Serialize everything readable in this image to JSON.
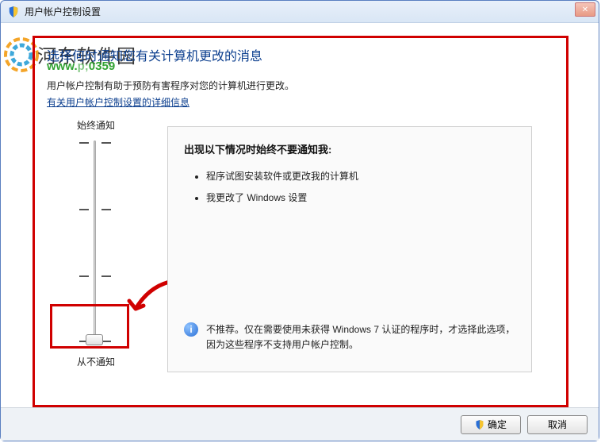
{
  "window": {
    "title": "用户帐户控制设置"
  },
  "page": {
    "heading": "选择何时通知您有关计算机更改的消息",
    "subtext": "用户帐户控制有助于预防有害程序对您的计算机进行更改。",
    "link": "有关用户帐户控制设置的详细信息"
  },
  "slider": {
    "top_label": "始终通知",
    "bottom_label": "从不通知"
  },
  "panel": {
    "heading": "出现以下情况时始终不要通知我:",
    "bullets": [
      "程序试图安装软件或更改我的计算机",
      "我更改了 Windows 设置"
    ],
    "recommendation": "不推荐。仅在需要使用未获得 Windows 7 认证的程序时，才选择此选项，因为这些程序不支持用户帐户控制。"
  },
  "buttons": {
    "ok": "确定",
    "cancel": "取消"
  },
  "watermark": {
    "site_name": "河东软件园",
    "url_prefix": "www.",
    "url_suffix": "0359"
  }
}
